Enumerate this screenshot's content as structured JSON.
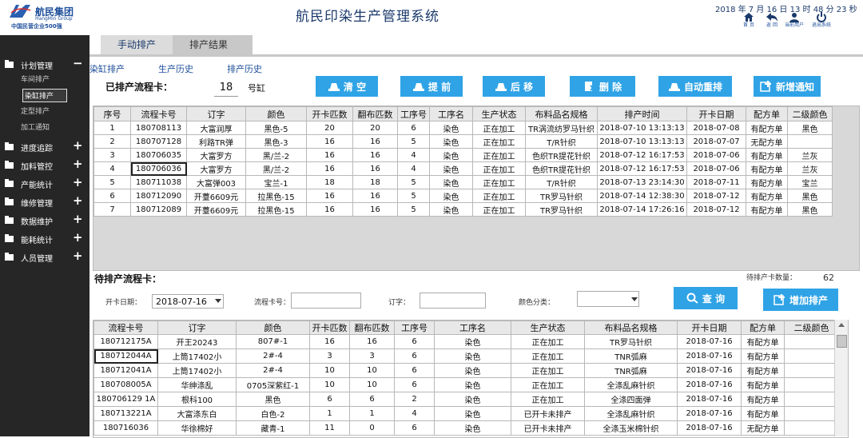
{
  "header": {
    "logo_name": "航民集团",
    "logo_sub_en": "HangMin Group",
    "logo_sub": "中国民营企业500强",
    "title": "航民印染生产管理系统",
    "datetime": "2018 年 7 月 16 日  13 时 48 分 23 秒",
    "buttons": [
      {
        "label": "首 页",
        "icon": "home-icon"
      },
      {
        "label": "返 回",
        "icon": "back-icon"
      },
      {
        "label": "当前用户",
        "icon": "user-icon"
      },
      {
        "label": "退出系统",
        "icon": "power-icon"
      }
    ]
  },
  "sidebar": {
    "groups": [
      {
        "label": "计划管理",
        "toggle": "−",
        "subitems": [
          "车间排产",
          "染缸排产",
          "定型排产",
          "加工通知"
        ],
        "active_sub": 1
      },
      {
        "label": "进度追踪",
        "toggle": "+"
      },
      {
        "label": "加料管控",
        "toggle": "+"
      },
      {
        "label": "产能统计",
        "toggle": "+"
      },
      {
        "label": "维修管理",
        "toggle": "+"
      },
      {
        "label": "数据维护",
        "toggle": "+"
      },
      {
        "label": "能耗统计",
        "toggle": "+"
      },
      {
        "label": "人员管理",
        "toggle": "+"
      }
    ]
  },
  "tabs": [
    {
      "label": "手动排产",
      "active": true
    },
    {
      "label": "排产结果",
      "active": false
    }
  ],
  "subtabs": [
    "染缸排产",
    "生产历史",
    "排产历史"
  ],
  "scheduled": {
    "caption": "已排产流程卡：",
    "machine_no": "18",
    "machine_unit": "号缸",
    "buttons": [
      {
        "label": "清 空",
        "icon": "clear-icon"
      },
      {
        "label": "提 前",
        "icon": "move-up-icon"
      },
      {
        "label": "后 移",
        "icon": "move-down-icon"
      },
      {
        "label": "删 除",
        "icon": "delete-icon"
      },
      {
        "label": "自动重排",
        "icon": "auto-arrange-icon"
      },
      {
        "label": "新增通知",
        "icon": "add-notice-icon"
      }
    ],
    "columns": [
      "序号",
      "流程卡号",
      "订字",
      "颜色",
      "开卡匹数",
      "翻布匹数",
      "工序号",
      "工序名",
      "生产状态",
      "布料品名规格",
      "排产时间",
      "开卡日期",
      "配方单",
      "二级颜色"
    ],
    "rows": [
      [
        "1",
        "180708113",
        "大富润厚",
        "黑色-5",
        "20",
        "20",
        "6",
        "染色",
        "正在加工",
        "TR涡流纺罗马针织",
        "2018-07-10 13:13:13",
        "2018-07-08",
        "有配方单",
        "黑色"
      ],
      [
        "2",
        "180707128",
        "利路TR弹",
        "黑色-3",
        "16",
        "16",
        "5",
        "染色",
        "正在加工",
        "T/R针织",
        "2018-07-10 13:13:13",
        "2018-07-07",
        "无配方单",
        ""
      ],
      [
        "3",
        "180706035",
        "大富罗方",
        "黑/兰-2",
        "16",
        "16",
        "4",
        "染色",
        "正在加工",
        "色织TR提花针织",
        "2018-07-12 16:17:53",
        "2018-07-06",
        "有配方单",
        "兰灰"
      ],
      [
        "4",
        "180706036",
        "大富罗方",
        "黑/兰-2",
        "16",
        "16",
        "4",
        "染色",
        "正在加工",
        "色织TR提花针织",
        "2018-07-12 16:17:53",
        "2018-07-06",
        "有配方单",
        "兰灰"
      ],
      [
        "5",
        "180711038",
        "大富弹003",
        "宝兰-1",
        "18",
        "18",
        "5",
        "染色",
        "正在加工",
        "T/R针织",
        "2018-07-13 23:14:30",
        "2018-07-11",
        "有配方单",
        "宝兰"
      ],
      [
        "6",
        "180712090",
        "开薹6609元",
        "拉黑色-15",
        "16",
        "16",
        "5",
        "染色",
        "正在加工",
        "TR罗马针织",
        "2018-07-14 12:38:30",
        "2018-07-12",
        "有配方单",
        "黑色"
      ],
      [
        "7",
        "180712089",
        "开薹6609元",
        "拉黑色-15",
        "16",
        "16",
        "5",
        "染色",
        "正在加工",
        "TR罗马针织",
        "2018-07-14 17:26:16",
        "2018-07-12",
        "有配方单",
        "黑色"
      ]
    ]
  },
  "pending": {
    "caption": "待排产流程卡：",
    "count_label": "待排产卡数量：",
    "count": "62",
    "filters": {
      "date_label": "开卡日期：",
      "date_value": "2018-07-16",
      "card_label": "流程卡号：",
      "order_label": "订字：",
      "color_label": "颜色分类："
    },
    "buttons": [
      {
        "label": "查 询",
        "icon": "search-icon"
      },
      {
        "label": "增加排产",
        "icon": "add-schedule-icon"
      }
    ],
    "columns": [
      "流程卡号",
      "订字",
      "颜色",
      "开卡匹数",
      "翻布匹数",
      "工序号",
      "工序名",
      "生产状态",
      "布料品名规格",
      "开卡日期",
      "配方单",
      "二级颜色"
    ],
    "rows": [
      [
        "180712175A",
        "开王20243",
        "807#-1",
        "16",
        "16",
        "6",
        "染色",
        "正在加工",
        "TR罗马针织",
        "2018-07-16",
        "有配方单",
        ""
      ],
      [
        "180712044A",
        "上筒17402小",
        "2#-4",
        "3",
        "3",
        "6",
        "染色",
        "正在加工",
        "TNR弧麻",
        "2018-07-16",
        "有配方单",
        ""
      ],
      [
        "180712041A",
        "上筒17402小",
        "2#-4",
        "10",
        "10",
        "6",
        "染色",
        "正在加工",
        "TNR弧麻",
        "2018-07-16",
        "有配方单",
        ""
      ],
      [
        "180708005A",
        "华绅涤乱",
        "0705深紫红-1",
        "10",
        "10",
        "6",
        "染色",
        "正在加工",
        "全涤乱麻针织",
        "2018-07-16",
        "有配方单",
        ""
      ],
      [
        "180706129 1A",
        "根科100",
        "黑色",
        "6",
        "6",
        "2",
        "染色",
        "正在加工",
        "全涤四面弹",
        "2018-07-16",
        "有配方单",
        ""
      ],
      [
        "180713221A",
        "大富涤东白",
        "白色-2",
        "1",
        "1",
        "4",
        "染色",
        "已开卡未排产",
        "全涤乱麻针织",
        "2018-07-16",
        "有配方单",
        ""
      ],
      [
        "180716036",
        "华徐棉好",
        "藏青-1",
        "11",
        "0",
        "6",
        "染色",
        "已开卡未排产",
        "全涤玉米棉针织",
        "2018-07-16",
        "无配方单",
        ""
      ]
    ]
  }
}
